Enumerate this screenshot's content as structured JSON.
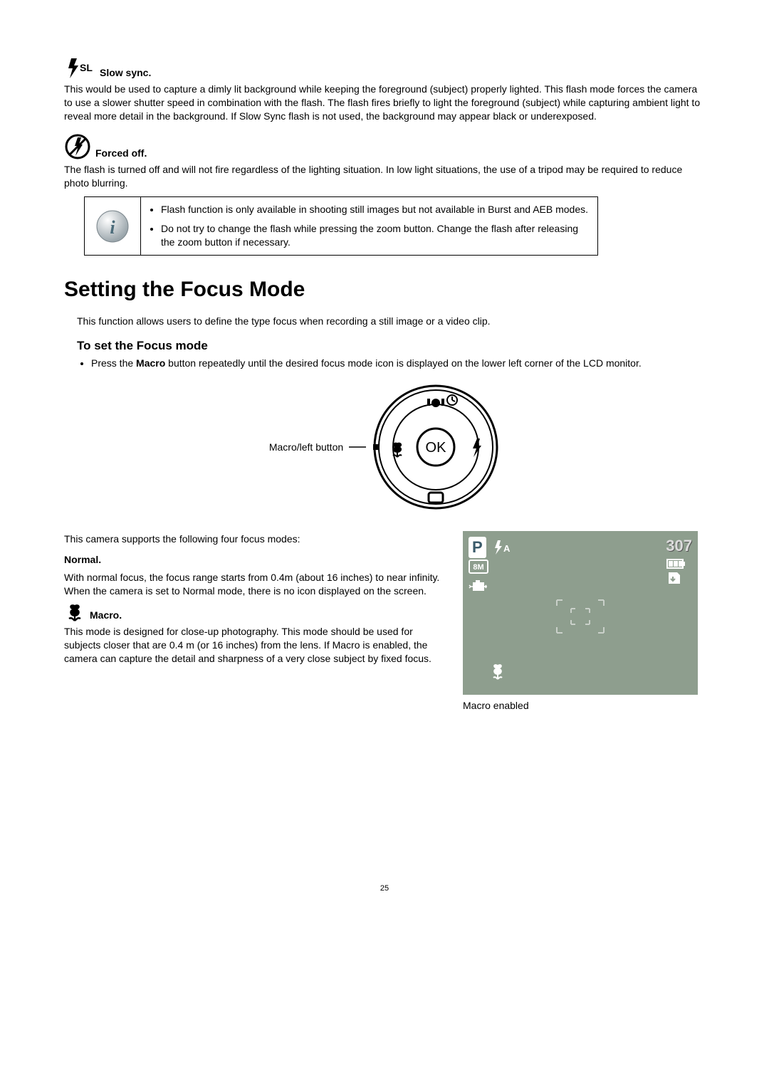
{
  "flash": {
    "slow_sync": {
      "title": "Slow sync.",
      "body": "This would be used to capture a dimly lit background while keeping the foreground (subject) properly lighted. This flash mode forces the camera to use a slower shutter speed in combination with the flash. The flash fires briefly to light the foreground (subject) while capturing ambient light to reveal more detail in the background. If Slow Sync flash is not used, the background may appear black or underexposed."
    },
    "forced_off": {
      "title": "Forced off.",
      "body": "The flash is turned off and will not fire regardless of the lighting situation. In low light situations, the use of a tripod may be required to reduce photo blurring."
    },
    "notes": {
      "n1": "Flash function is only available in shooting still images but not available in Burst and AEB modes.",
      "n2": "Do not try to change the flash while pressing the zoom button. Change the flash after releasing the zoom button if necessary."
    }
  },
  "focus": {
    "heading": "Setting the Focus Mode",
    "intro": "This function allows users to define the type focus when recording a still image or a video clip.",
    "subheading": "To set the Focus mode",
    "step_prefix": "Press the ",
    "step_bold": "Macro",
    "step_suffix": " button repeatedly until the desired focus mode icon is displayed on the lower left corner of the LCD monitor.",
    "controller_label": "Macro/left button",
    "controller_ok": "OK",
    "supports": "This camera supports the following four focus modes:",
    "normal": {
      "title": "Normal.",
      "body": "With normal focus, the focus range starts from 0.4m (about 16 inches) to near infinity. When the camera is set to Normal mode, there is no icon displayed on the screen."
    },
    "macro": {
      "title": "Macro.",
      "body": "This mode is designed for close-up photography. This mode should be used for subjects closer that are 0.4 m (or 16 inches) from the lens. If Macro is enabled, the camera can capture the detail and sharpness of a very close subject by fixed focus."
    },
    "lcd": {
      "mode": "P",
      "flash_auto": "A",
      "res": "8M",
      "shots": "307",
      "caption": "Macro enabled"
    }
  },
  "page": "25"
}
